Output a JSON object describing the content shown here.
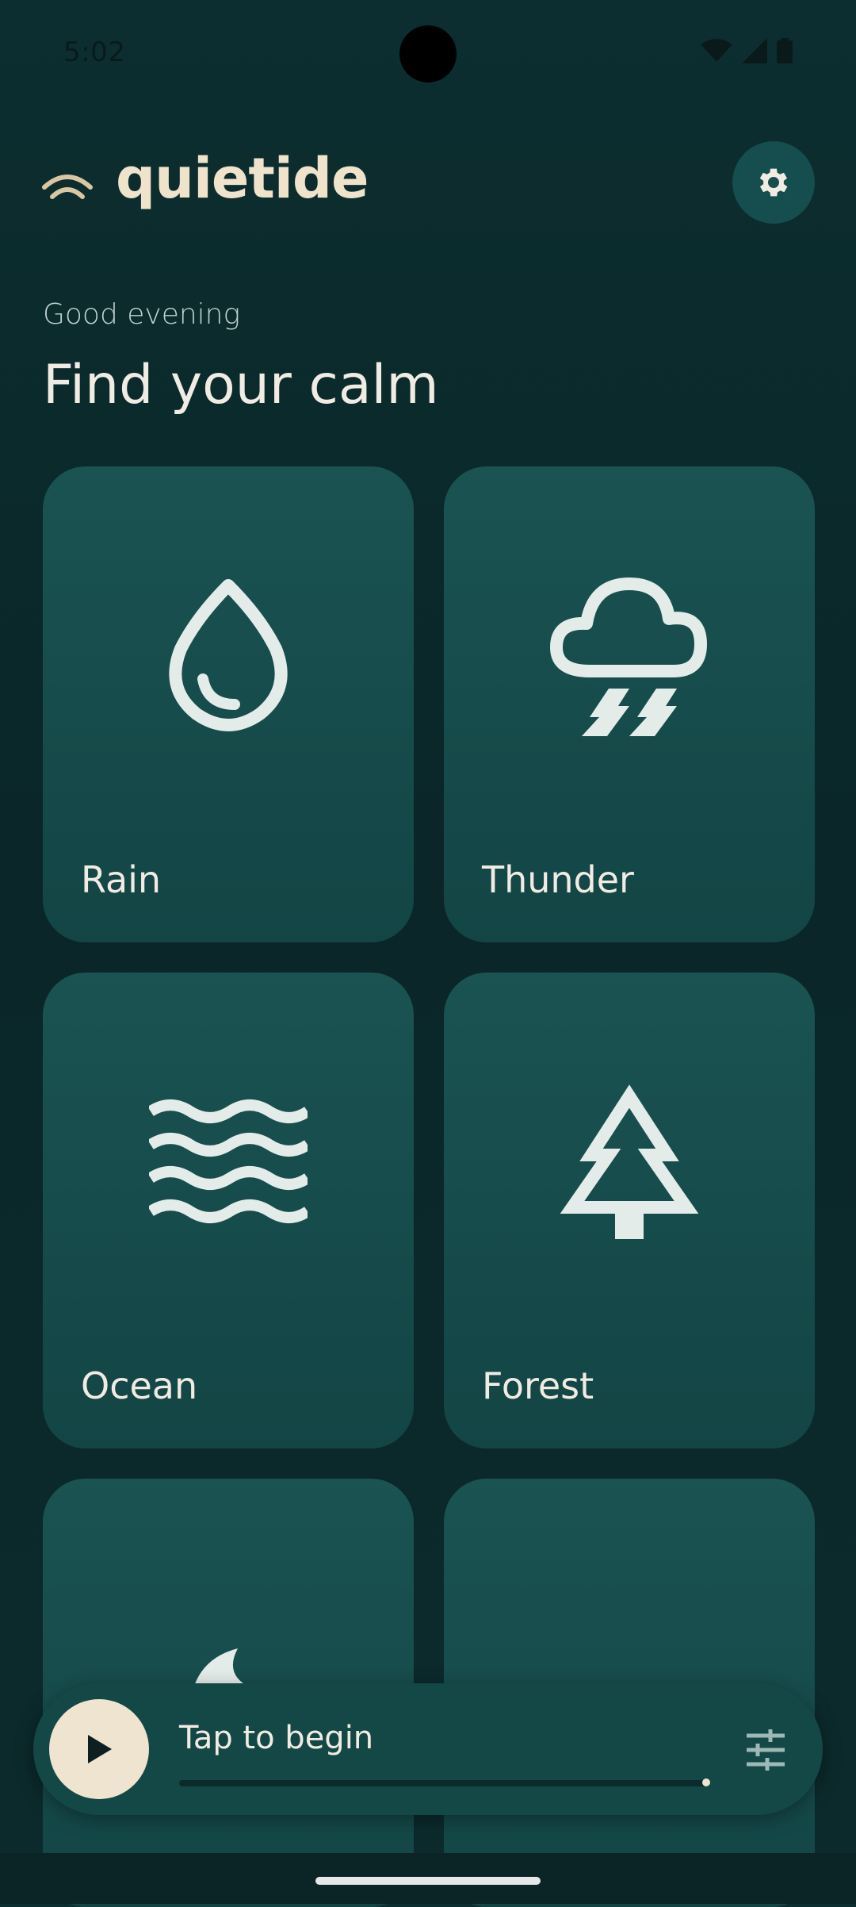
{
  "status_bar": {
    "time": "5:02"
  },
  "header": {
    "app_name": "quietide",
    "settings_icon": "gear-icon"
  },
  "greeting": "Good evening",
  "heading": "Find your calm",
  "tiles": [
    {
      "label": "Rain",
      "icon": "water-drop-icon"
    },
    {
      "label": "Thunder",
      "icon": "thunderstorm-icon"
    },
    {
      "label": "Ocean",
      "icon": "waves-icon"
    },
    {
      "label": "Forest",
      "icon": "tree-icon"
    },
    {
      "label": "",
      "icon": "moon-icon"
    },
    {
      "label": "",
      "icon": "cloud-icon"
    }
  ],
  "player": {
    "status_text": "Tap to begin",
    "progress": 1.0,
    "play_icon": "play-icon",
    "mixer_icon": "sliders-icon"
  },
  "colors": {
    "background": "#0a2628",
    "tile": "#164d4e",
    "accent_cream": "#efe4d0",
    "logo_arc": "#d9c7a4"
  }
}
